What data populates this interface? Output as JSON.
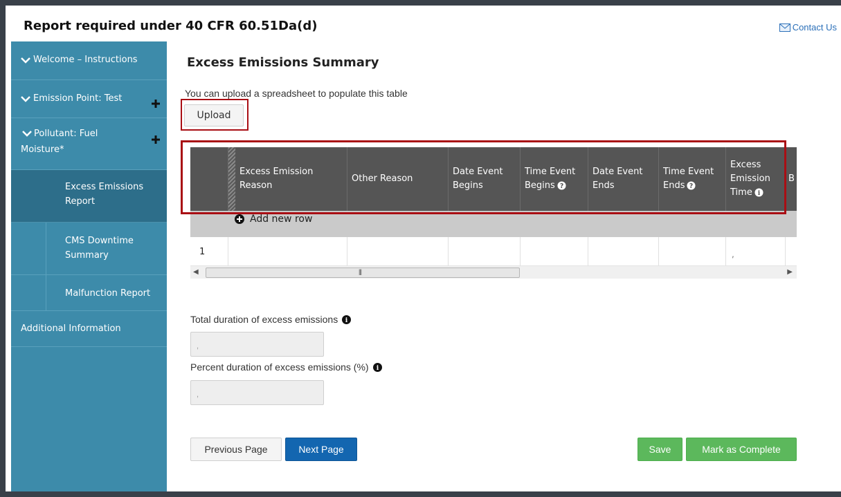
{
  "header": {
    "title": "Report required under 40 CFR 60.51Da(d)",
    "contact_label": "Contact Us"
  },
  "sidebar": {
    "items": [
      {
        "label": "Welcome – Instructions"
      },
      {
        "label": "Emission Point: Test"
      },
      {
        "label": "Pollutant: Fuel",
        "label2": "Moisture*"
      },
      {
        "label": "Excess Emissions",
        "label2": "Report"
      },
      {
        "label": "CMS Downtime",
        "label2": "Summary"
      },
      {
        "label": "Malfunction Report"
      },
      {
        "label": "Additional Information"
      }
    ]
  },
  "main": {
    "title": "Excess Emissions Summary",
    "upload_text": "You can upload a spreadsheet to populate this table",
    "upload_label": "Upload",
    "table": {
      "columns": [
        {
          "l1": "Excess Emission",
          "l2": "Reason",
          "l3": ""
        },
        {
          "l1": "Other Reason",
          "l2": "",
          "l3": ""
        },
        {
          "l1": "Date Event",
          "l2": "Begins",
          "l3": ""
        },
        {
          "l1": "Time Event",
          "l2": "Begins",
          "l3": ""
        },
        {
          "l1": "Date Event",
          "l2": "Ends",
          "l3": ""
        },
        {
          "l1": "Time Event",
          "l2": "Ends",
          "l3": ""
        },
        {
          "l1": "Excess",
          "l2": "Emission",
          "l3": "Time"
        },
        {
          "l1": "B",
          "l2": "",
          "l3": ""
        }
      ],
      "add_row_label": "Add new row",
      "rows": [
        {
          "num": "1",
          "excess_time": ","
        }
      ]
    },
    "duration_label": "Total duration of excess emissions",
    "duration_value": ",",
    "percent_label": "Percent duration of excess emissions (%)",
    "percent_value": ",",
    "buttons": {
      "previous": "Previous Page",
      "next": "Next Page",
      "save": "Save",
      "complete": "Mark as Complete"
    }
  },
  "colors": {
    "sidebar_bg": "#3d8baa",
    "sidebar_active": "#2d6e8a",
    "table_header": "#555555",
    "highlight_border": "#a90e14",
    "primary": "#1366b0",
    "success": "#5cb85c"
  }
}
